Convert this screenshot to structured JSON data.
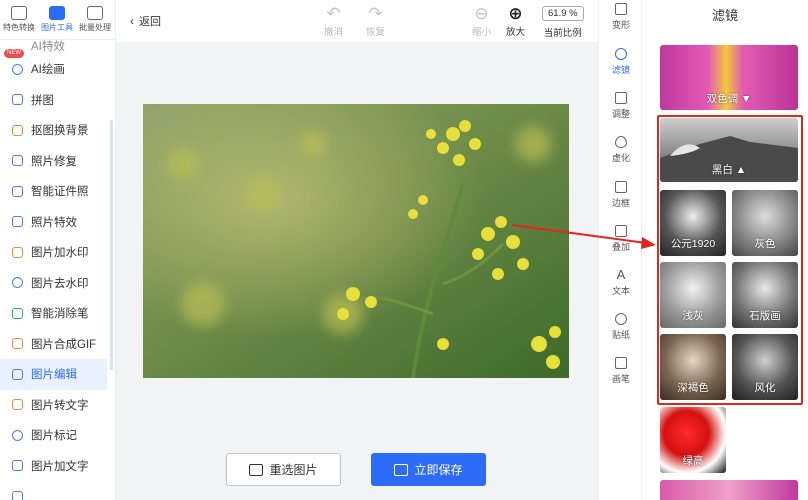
{
  "top_tabs": [
    {
      "label": "特色转换",
      "icon": "star-icon",
      "active": false
    },
    {
      "label": "图片工具",
      "icon": "image-tools-icon",
      "active": true
    },
    {
      "label": "批量处理",
      "icon": "batch-icon",
      "active": false
    }
  ],
  "menu": {
    "partial_top": "AI特效",
    "items": [
      {
        "label": "AI绘画",
        "badge": "NEW",
        "icon": "ai-paint-icon"
      },
      {
        "label": "拼图",
        "icon": "collage-icon"
      },
      {
        "label": "抠图换背景",
        "icon": "cutout-icon"
      },
      {
        "label": "照片修复",
        "icon": "photo-repair-icon"
      },
      {
        "label": "智能证件照",
        "icon": "id-photo-icon"
      },
      {
        "label": "照片特效",
        "icon": "photo-effect-icon"
      },
      {
        "label": "图片加水印",
        "icon": "watermark-icon"
      },
      {
        "label": "图片去水印",
        "icon": "remove-watermark-icon"
      },
      {
        "label": "智能消除笔",
        "icon": "eraser-pen-icon"
      },
      {
        "label": "图片合成GIF",
        "icon": "gif-icon"
      },
      {
        "label": "图片编辑",
        "icon": "edit-image-icon",
        "active": true
      },
      {
        "label": "图片转文字",
        "icon": "ocr-icon"
      },
      {
        "label": "图片标记",
        "icon": "mark-icon"
      },
      {
        "label": "图片加文字",
        "icon": "add-text-icon"
      }
    ]
  },
  "toolbar": {
    "back": "返回",
    "undo": "撤消",
    "redo": "恢复",
    "zoom_out": "缩小",
    "zoom_in": "放大",
    "zoom_value": "61.9 %",
    "current_ratio": "当前比例"
  },
  "actions": {
    "reselect": "重选图片",
    "save": "立即保存"
  },
  "tools": [
    {
      "label": "变形",
      "icon": "transform-icon"
    },
    {
      "label": "滤镜",
      "icon": "filter-icon",
      "active": true
    },
    {
      "label": "调整",
      "icon": "adjust-icon"
    },
    {
      "label": "虚化",
      "icon": "blur-icon"
    },
    {
      "label": "边框",
      "icon": "frame-icon"
    },
    {
      "label": "叠加",
      "icon": "overlay-icon"
    },
    {
      "label": "文本",
      "icon": "text-icon"
    },
    {
      "label": "贴纸",
      "icon": "sticker-icon"
    },
    {
      "label": "画笔",
      "icon": "brush-icon"
    }
  ],
  "filter_panel": {
    "title": "滤镜",
    "categories": [
      {
        "label": "双色调 ▼"
      },
      {
        "label": "黑白 ▲"
      }
    ],
    "bw_presets": [
      "公元1920",
      "灰色",
      "浅灰",
      "石版画",
      "深褐色",
      "风化"
    ],
    "more_preset": "绿高"
  },
  "colors": {
    "accent": "#2d6cf6",
    "highlight_red": "#e0261f"
  }
}
